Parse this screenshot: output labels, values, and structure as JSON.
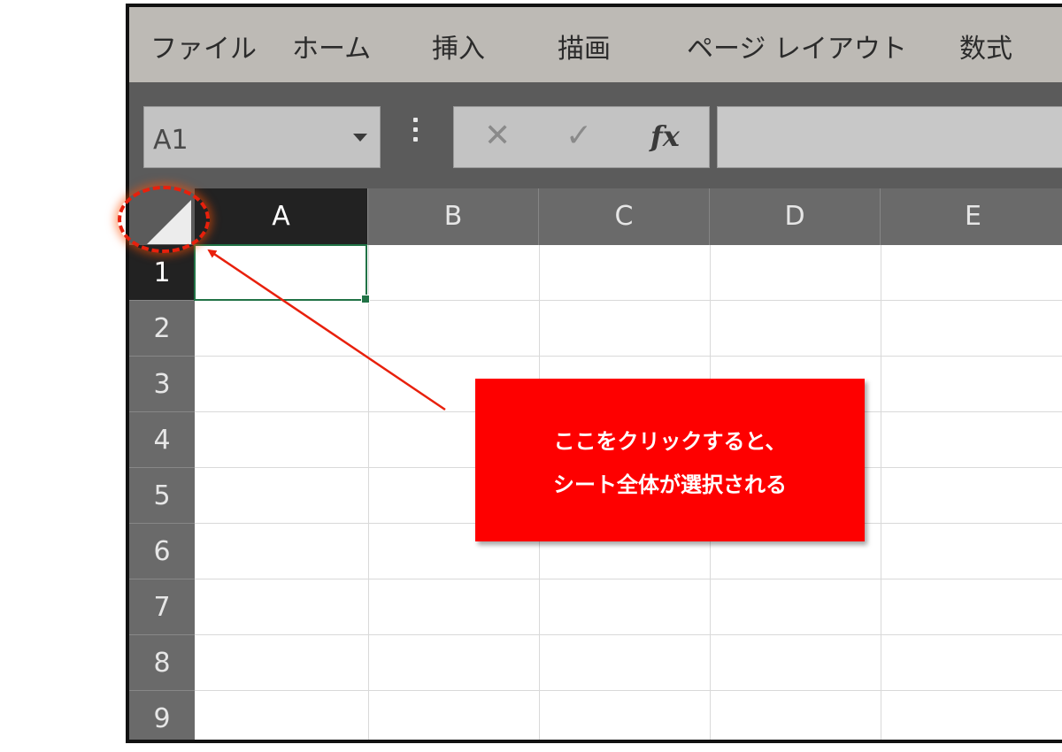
{
  "menu": {
    "items": [
      "ファイル",
      "ホーム",
      "挿入",
      "描画",
      "ページ レイアウト",
      "数式"
    ]
  },
  "formula_bar": {
    "name_box_value": "A1",
    "cancel_glyph": "✕",
    "enter_glyph": "✓",
    "fx_label": "fx",
    "formula_value": ""
  },
  "sheet": {
    "columns": [
      "A",
      "B",
      "C",
      "D",
      "E"
    ],
    "rows": [
      "1",
      "2",
      "3",
      "4",
      "5",
      "6",
      "7",
      "8",
      "9"
    ],
    "active_cell": "A1"
  },
  "annotation": {
    "line1": "ここをクリックすると、",
    "line2": "シート全体が選択される",
    "callout_color": "#fe0000",
    "highlight_color": "#e8200c"
  },
  "theme": {
    "selection_green": "#217346"
  }
}
